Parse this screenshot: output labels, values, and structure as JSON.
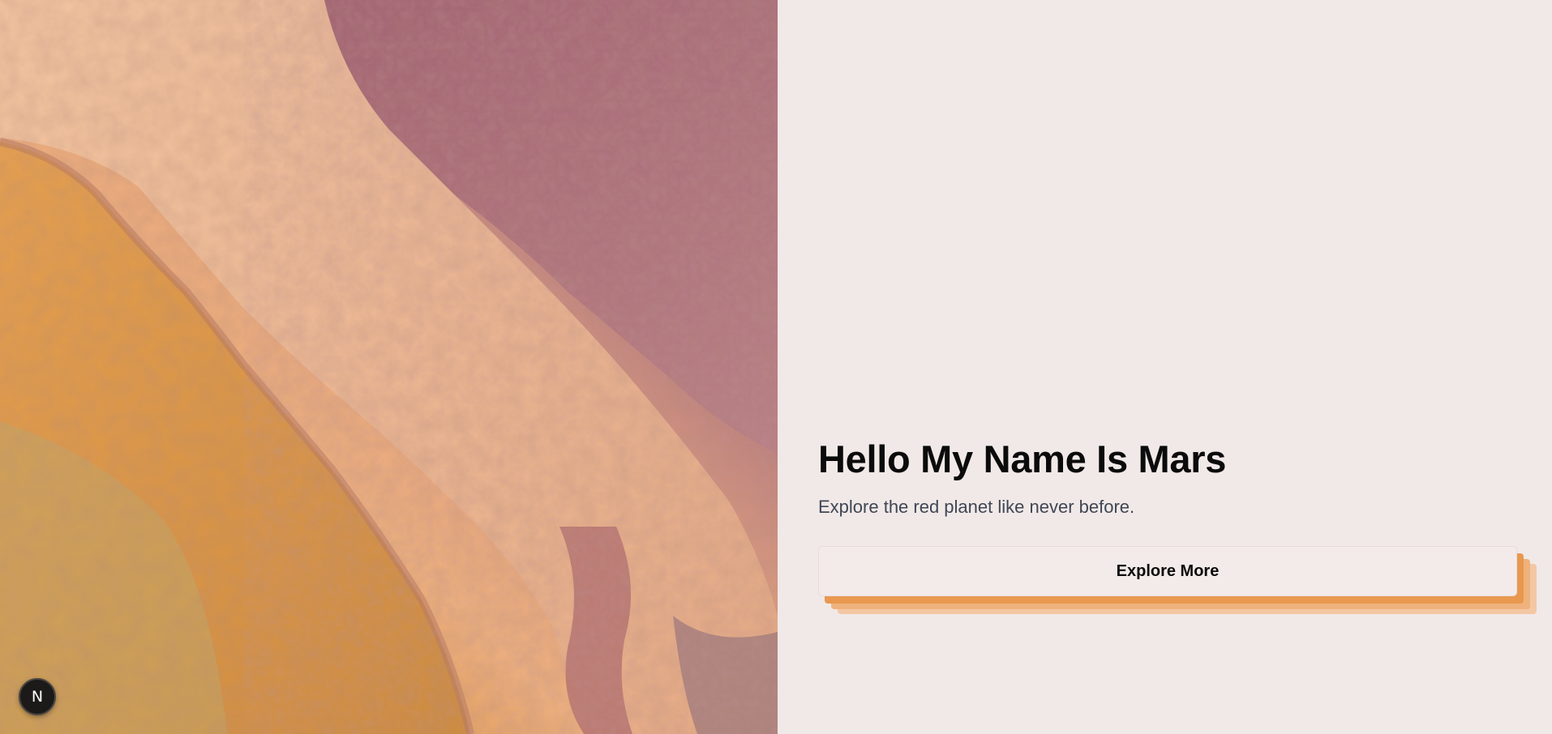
{
  "hero": {
    "headline": "Hello My Name Is Mars",
    "subtitle": "Explore the red planet like never before.",
    "cta_label": "Explore More"
  },
  "image": {
    "description_icon": "mars-terrain-image"
  },
  "dev_badge": {
    "label": "N",
    "icon": "nextjs-logo-icon"
  },
  "colors": {
    "background": "#f1e9e8",
    "headline": "#0b0b0b",
    "subtitle": "#3f4654",
    "cta_shadow_accent": "#e9984f",
    "button_bg": "#f2ebea"
  }
}
